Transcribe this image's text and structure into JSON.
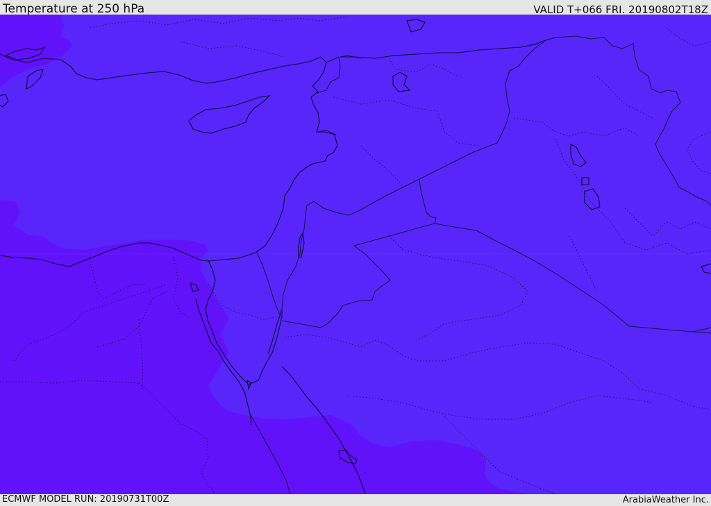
{
  "header": {
    "title": "Temperature at 250 hPa",
    "valid": "VALID T+066 FRI. 20190802T18Z"
  },
  "footer": {
    "model_run": "ECMWF MODEL RUN: 20190731T00Z",
    "credit": "ArabiaWeather Inc."
  },
  "map": {
    "colors": {
      "main_fill": "#5826fb",
      "warm_fill": "#6212fb",
      "coastline": "#0b0b30",
      "border": "#141440"
    }
  }
}
